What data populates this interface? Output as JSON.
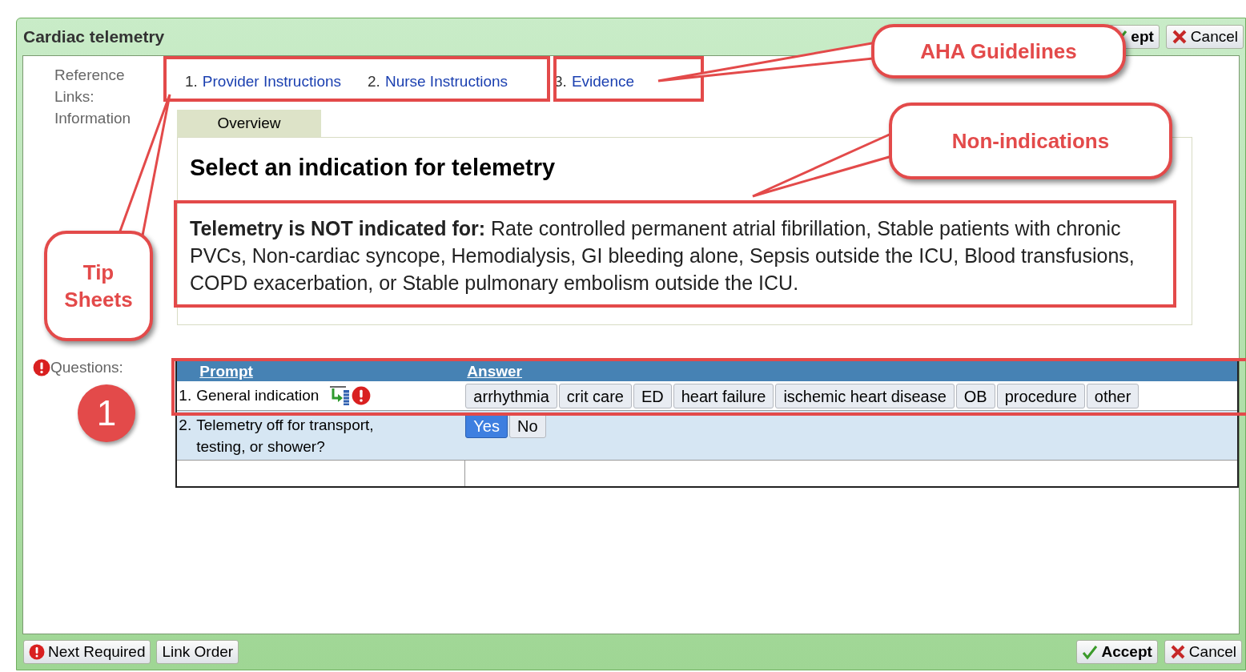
{
  "window": {
    "title": "Cardiac telemetry"
  },
  "title_buttons": [
    {
      "kind": "accept",
      "label": "ept"
    },
    {
      "kind": "cancel",
      "label": "Cancel"
    }
  ],
  "side_labels": [
    "Reference",
    "Links:",
    "Information"
  ],
  "reference_links": [
    {
      "number": "1.",
      "label": "Provider Instructions"
    },
    {
      "number": "2.",
      "label": "Nurse Instructions"
    },
    {
      "number": "3.",
      "label": "Evidence"
    }
  ],
  "tabs": [
    {
      "label": "Overview",
      "selected": true
    }
  ],
  "panel": {
    "heading": "Select an indication for telemetry",
    "text": "**Telemetry is NOT indicated for:** Rate controlled permanent atrial fibrillation, Stable patients with chronic PVCs, Non-cardiac syncope, Hemodialysis, GI bleeding alone, Sepsis outside the ICU, Blood transfusions, COPD exacerbation, or Stable pulmonary embolism outside the ICU."
  },
  "questions": {
    "label": "Questions:",
    "required": true,
    "columns": [
      "Prompt",
      "Answer"
    ],
    "rows": [
      {
        "number": "1.",
        "prompt": "General indication",
        "required": true,
        "selected": false,
        "answers": [
          {
            "label": "arrhythmia",
            "selected": false
          },
          {
            "label": "crit care",
            "selected": false
          },
          {
            "label": "ED",
            "selected": false
          },
          {
            "label": "heart failure",
            "selected": false
          },
          {
            "label": "ischemic heart disease",
            "selected": false
          },
          {
            "label": "OB",
            "selected": false
          },
          {
            "label": "procedure",
            "selected": false
          },
          {
            "label": "other",
            "selected": false
          }
        ]
      },
      {
        "number": "2.",
        "prompt": "Telemetry off for transport, testing, or shower?",
        "required": false,
        "selected": true,
        "answers": [
          {
            "label": "Yes",
            "selected": true
          },
          {
            "label": "No",
            "selected": false
          }
        ]
      }
    ]
  },
  "footer_buttons": [
    {
      "kind": "required",
      "label": "Next Required"
    },
    {
      "kind": "plain",
      "label": "Link Order"
    },
    {
      "kind": "accept",
      "label": "Accept"
    },
    {
      "kind": "cancel",
      "label": "Cancel"
    }
  ],
  "annotations": {
    "callouts": [
      "AHA Guidelines",
      "Non-indications",
      "Tip Sheets"
    ],
    "marker": "1"
  }
}
